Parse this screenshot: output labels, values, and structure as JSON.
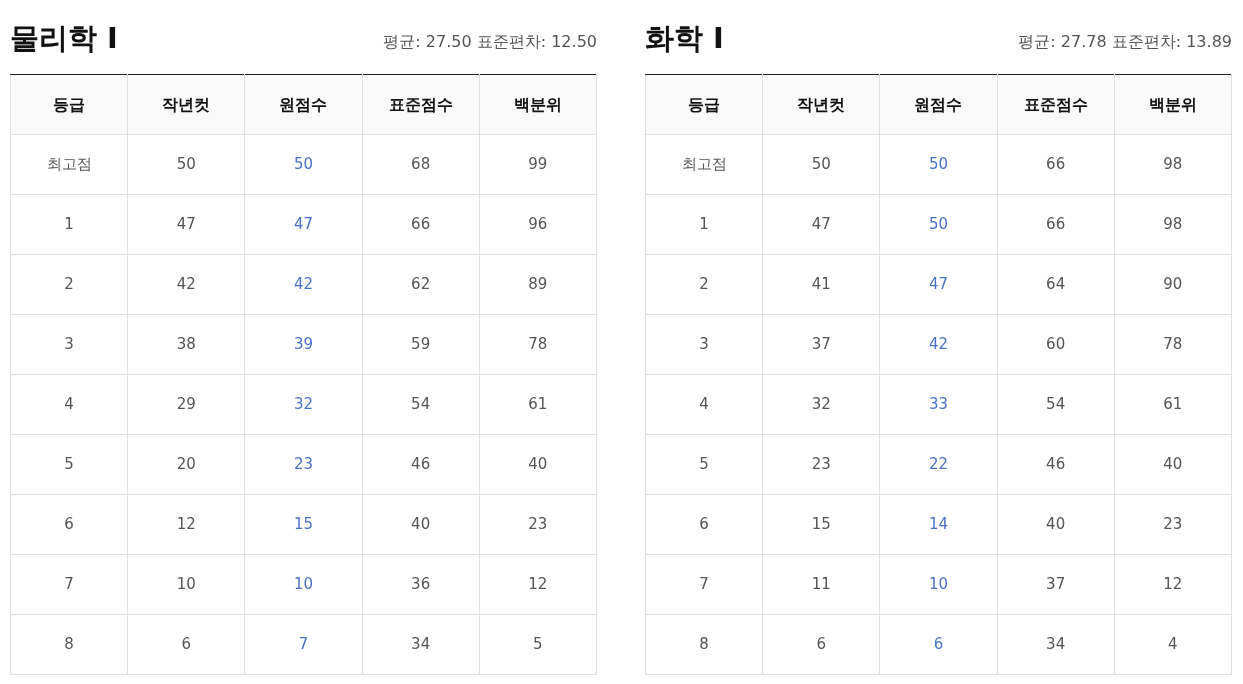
{
  "panels": [
    {
      "title": "물리학 Ⅰ",
      "stats": "평균: 27.50 표준편차: 12.50",
      "columns": [
        {
          "label": "등급",
          "highlighted": false
        },
        {
          "label": "작년컷",
          "highlighted": false
        },
        {
          "label": "원점수",
          "highlighted": true
        },
        {
          "label": "표준점수",
          "highlighted": false
        },
        {
          "label": "백분위",
          "highlighted": false
        }
      ],
      "rows": [
        [
          "최고점",
          "50",
          "50",
          "68",
          "99"
        ],
        [
          "1",
          "47",
          "47",
          "66",
          "96"
        ],
        [
          "2",
          "42",
          "42",
          "62",
          "89"
        ],
        [
          "3",
          "38",
          "39",
          "59",
          "78"
        ],
        [
          "4",
          "29",
          "32",
          "54",
          "61"
        ],
        [
          "5",
          "20",
          "23",
          "46",
          "40"
        ],
        [
          "6",
          "12",
          "15",
          "40",
          "23"
        ],
        [
          "7",
          "10",
          "10",
          "36",
          "12"
        ],
        [
          "8",
          "6",
          "7",
          "34",
          "5"
        ]
      ]
    },
    {
      "title": "화학 Ⅰ",
      "stats": "평균: 27.78 표준편차: 13.89",
      "columns": [
        {
          "label": "등급",
          "highlighted": false
        },
        {
          "label": "작년컷",
          "highlighted": false
        },
        {
          "label": "원점수",
          "highlighted": true
        },
        {
          "label": "표준점수",
          "highlighted": false
        },
        {
          "label": "백분위",
          "highlighted": false
        }
      ],
      "rows": [
        [
          "최고점",
          "50",
          "50",
          "66",
          "98"
        ],
        [
          "1",
          "47",
          "50",
          "66",
          "98"
        ],
        [
          "2",
          "41",
          "47",
          "64",
          "90"
        ],
        [
          "3",
          "37",
          "42",
          "60",
          "78"
        ],
        [
          "4",
          "32",
          "33",
          "54",
          "61"
        ],
        [
          "5",
          "23",
          "22",
          "46",
          "40"
        ],
        [
          "6",
          "15",
          "14",
          "40",
          "23"
        ],
        [
          "7",
          "11",
          "10",
          "37",
          "12"
        ],
        [
          "8",
          "6",
          "6",
          "34",
          "4"
        ]
      ]
    }
  ]
}
